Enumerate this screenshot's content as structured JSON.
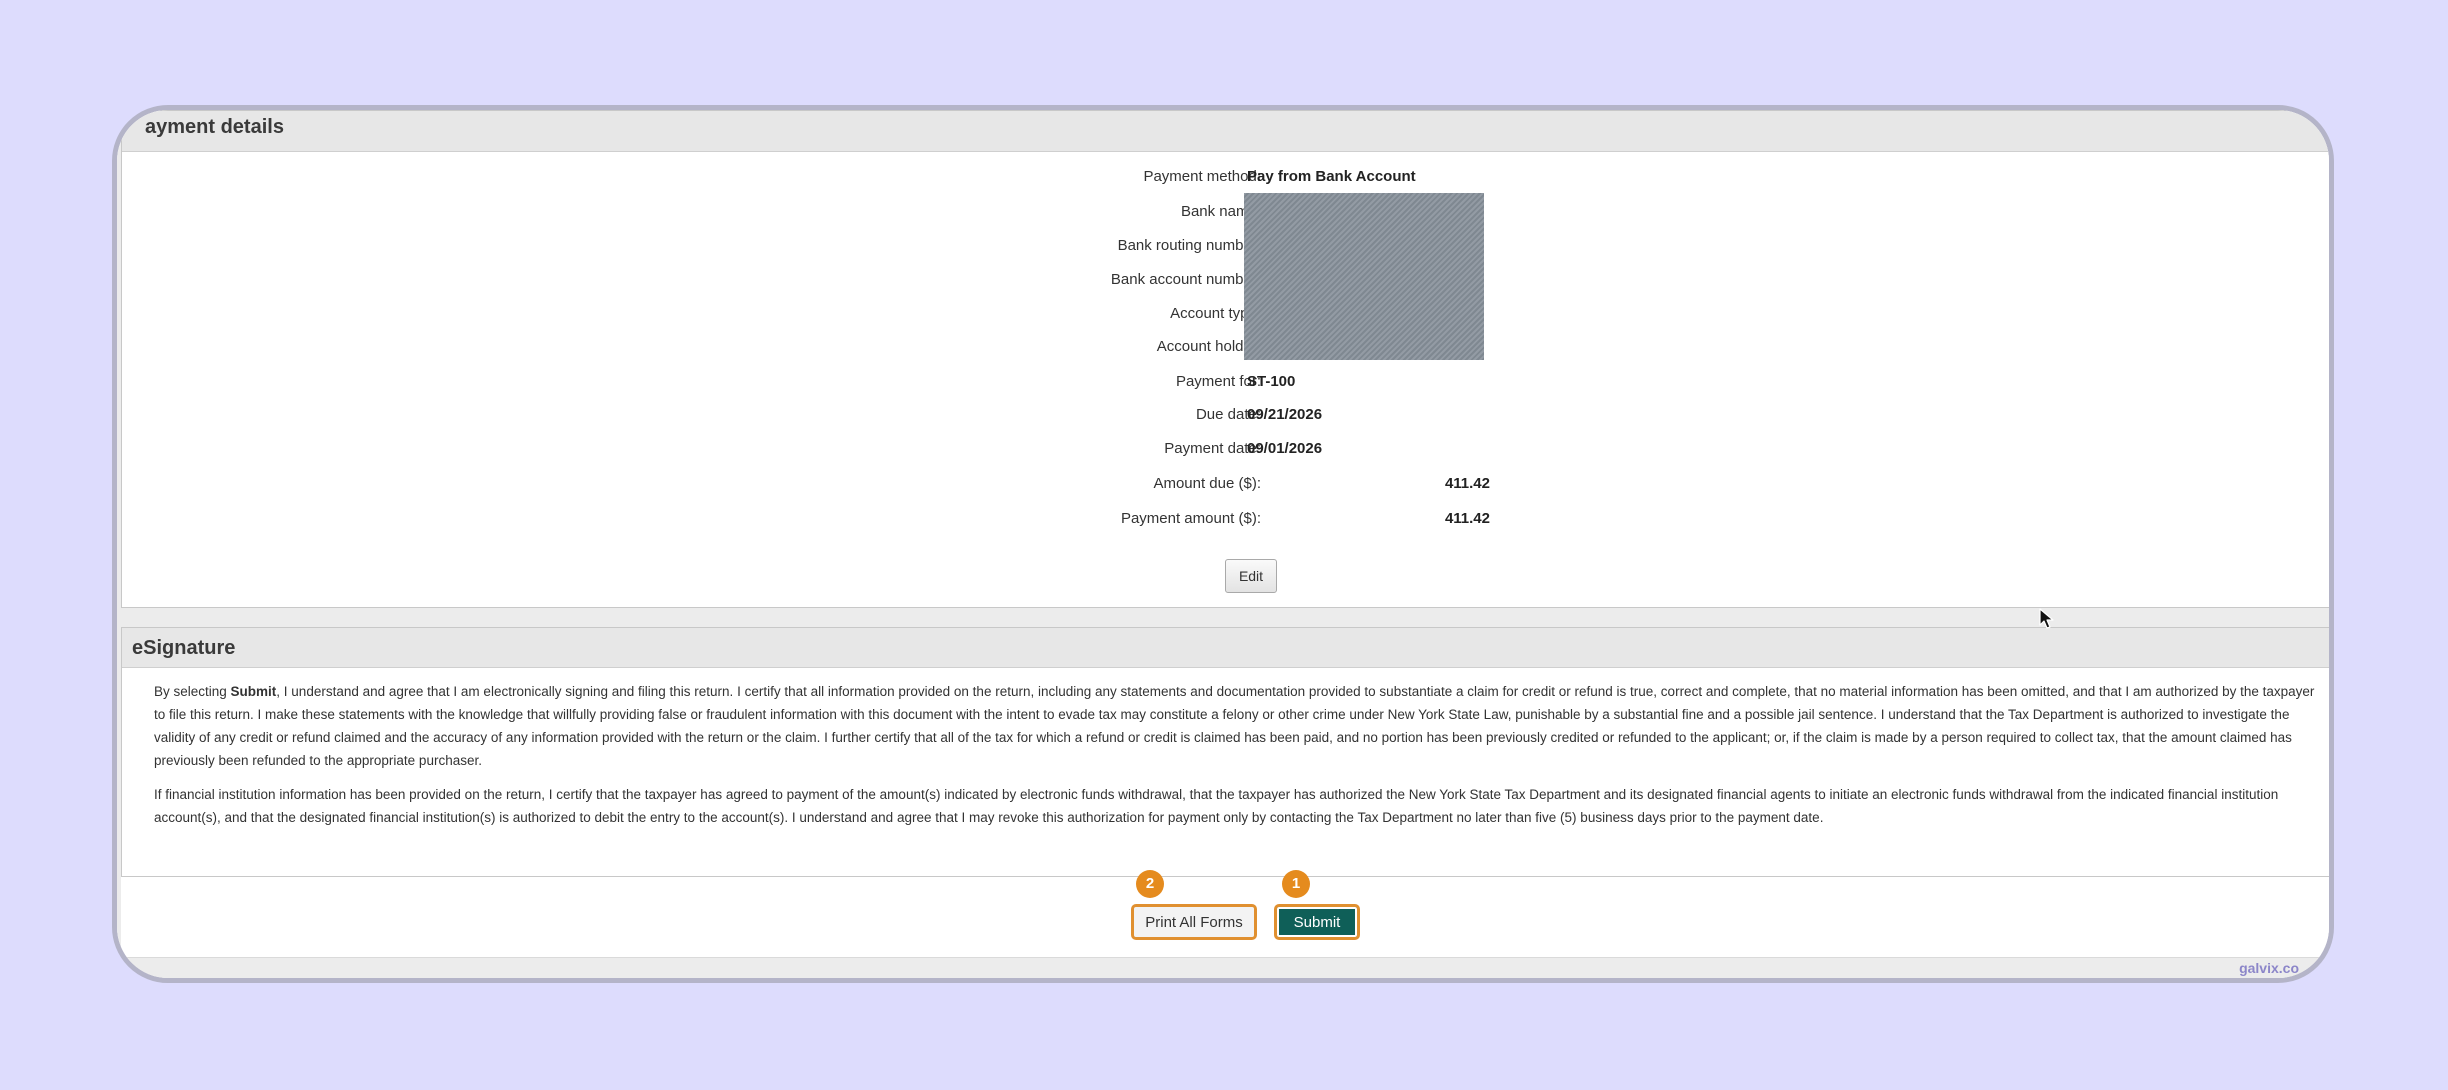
{
  "payment_details": {
    "title": "ayment details",
    "fields": [
      {
        "label": "Payment method:",
        "value": "Pay from Bank Account"
      },
      {
        "label": "Bank name:",
        "value": ""
      },
      {
        "label": "Bank routing number:",
        "value": ""
      },
      {
        "label": "Bank account number:",
        "value": ""
      },
      {
        "label": "Account type:",
        "value": ""
      },
      {
        "label": "Account holder:",
        "value": ""
      },
      {
        "label": "Payment for:",
        "value": "ST-100"
      },
      {
        "label": "Due date:",
        "value": "09/21/2026"
      },
      {
        "label": "Payment date:",
        "value": "09/01/2026"
      },
      {
        "label": "Amount due ($):",
        "value": "411.42"
      },
      {
        "label": "Payment amount ($):",
        "value": "411.42"
      }
    ],
    "edit_label": "Edit"
  },
  "esignature": {
    "title": "eSignature",
    "p1_prefix": "By selecting ",
    "p1_bold": "Submit",
    "p1_rest": ", I understand and agree that I am electronically signing and filing this return. I certify that all information provided on the return, including any statements and documentation provided to substantiate a claim for credit or refund is true, correct and complete, that no material information has been omitted, and that I am authorized by the taxpayer to file this return. I make these statements with the knowledge that willfully providing false or fraudulent information with this document with the intent to evade tax may constitute a felony or other crime under New York State Law, punishable by a substantial fine and a possible jail sentence. I understand that the Tax Department is authorized to investigate the validity of any credit or refund claimed and the accuracy of any information provided with the return or the claim. I further certify that all of the tax for which a refund or credit is claimed has been paid, and no portion has been previously credited or refunded to the applicant; or, if the claim is made by a person required to collect tax, that the amount claimed has previously been refunded to the appropriate purchaser.",
    "p2": "If financial institution information has been provided on the return, I certify that the taxpayer has agreed to payment of the amount(s) indicated by electronic funds withdrawal, that the taxpayer has authorized the New York State Tax Department and its designated financial agents to initiate an electronic funds withdrawal from the indicated financial institution account(s), and that the designated financial institution(s) is authorized to debit the entry to the account(s). I understand and agree that I may revoke this authorization for payment only by contacting the Tax Department no later than five (5) business days prior to the payment date."
  },
  "actions": {
    "print_label": "Print All Forms",
    "submit_label": "Submit",
    "print_step": "2",
    "submit_step": "1"
  },
  "watermark": "galvix.co",
  "colors": {
    "background": "#dddcfd",
    "submit": "#0f5f58",
    "highlight": "#e09030",
    "badge": "#e58b1e"
  }
}
